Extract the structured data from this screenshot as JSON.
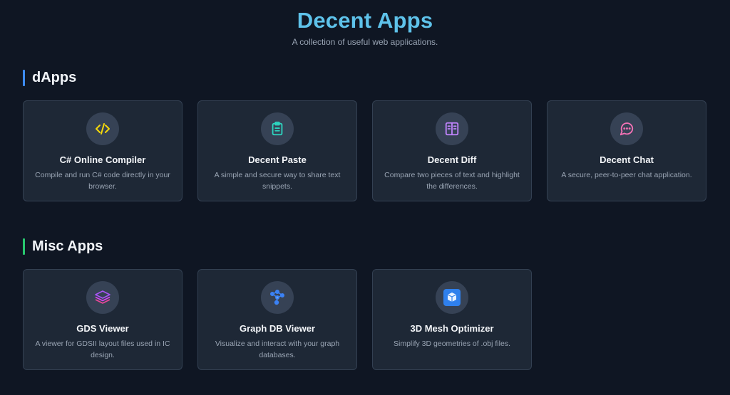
{
  "header": {
    "title": "Decent Apps",
    "subtitle": "A collection of useful web applications."
  },
  "sections": [
    {
      "heading": "dApps",
      "accent_color": "#3d8bf0",
      "apps": [
        {
          "title": "C# Online Compiler",
          "description": "Compile and run C# code directly in your browser.",
          "icon": "code-icon",
          "icon_color": "#f5d90a"
        },
        {
          "title": "Decent Paste",
          "description": "A simple and secure way to share text snippets.",
          "icon": "clipboard-icon",
          "icon_color": "#2dd4bf"
        },
        {
          "title": "Decent Diff",
          "description": "Compare two pieces of text and highlight the differences.",
          "icon": "diff-icon",
          "icon_color": "#c084fc"
        },
        {
          "title": "Decent Chat",
          "description": "A secure, peer-to-peer chat application.",
          "icon": "chat-bubble-icon",
          "icon_color": "#f472b6"
        }
      ]
    },
    {
      "heading": "Misc Apps",
      "accent_color": "#28c76f",
      "apps": [
        {
          "title": "GDS Viewer",
          "description": "A viewer for GDSII layout files used in IC design.",
          "icon": "layers-icon",
          "icon_color": "#ec4899"
        },
        {
          "title": "Graph DB Viewer",
          "description": "Visualize and interact with your graph databases.",
          "icon": "graph-icon",
          "icon_color": "#3b82f6"
        },
        {
          "title": "3D Mesh Optimizer",
          "description": "Simplify 3D geometries of .obj files.",
          "icon": "cube-icon",
          "icon_color": "#2f80ed"
        }
      ]
    }
  ]
}
